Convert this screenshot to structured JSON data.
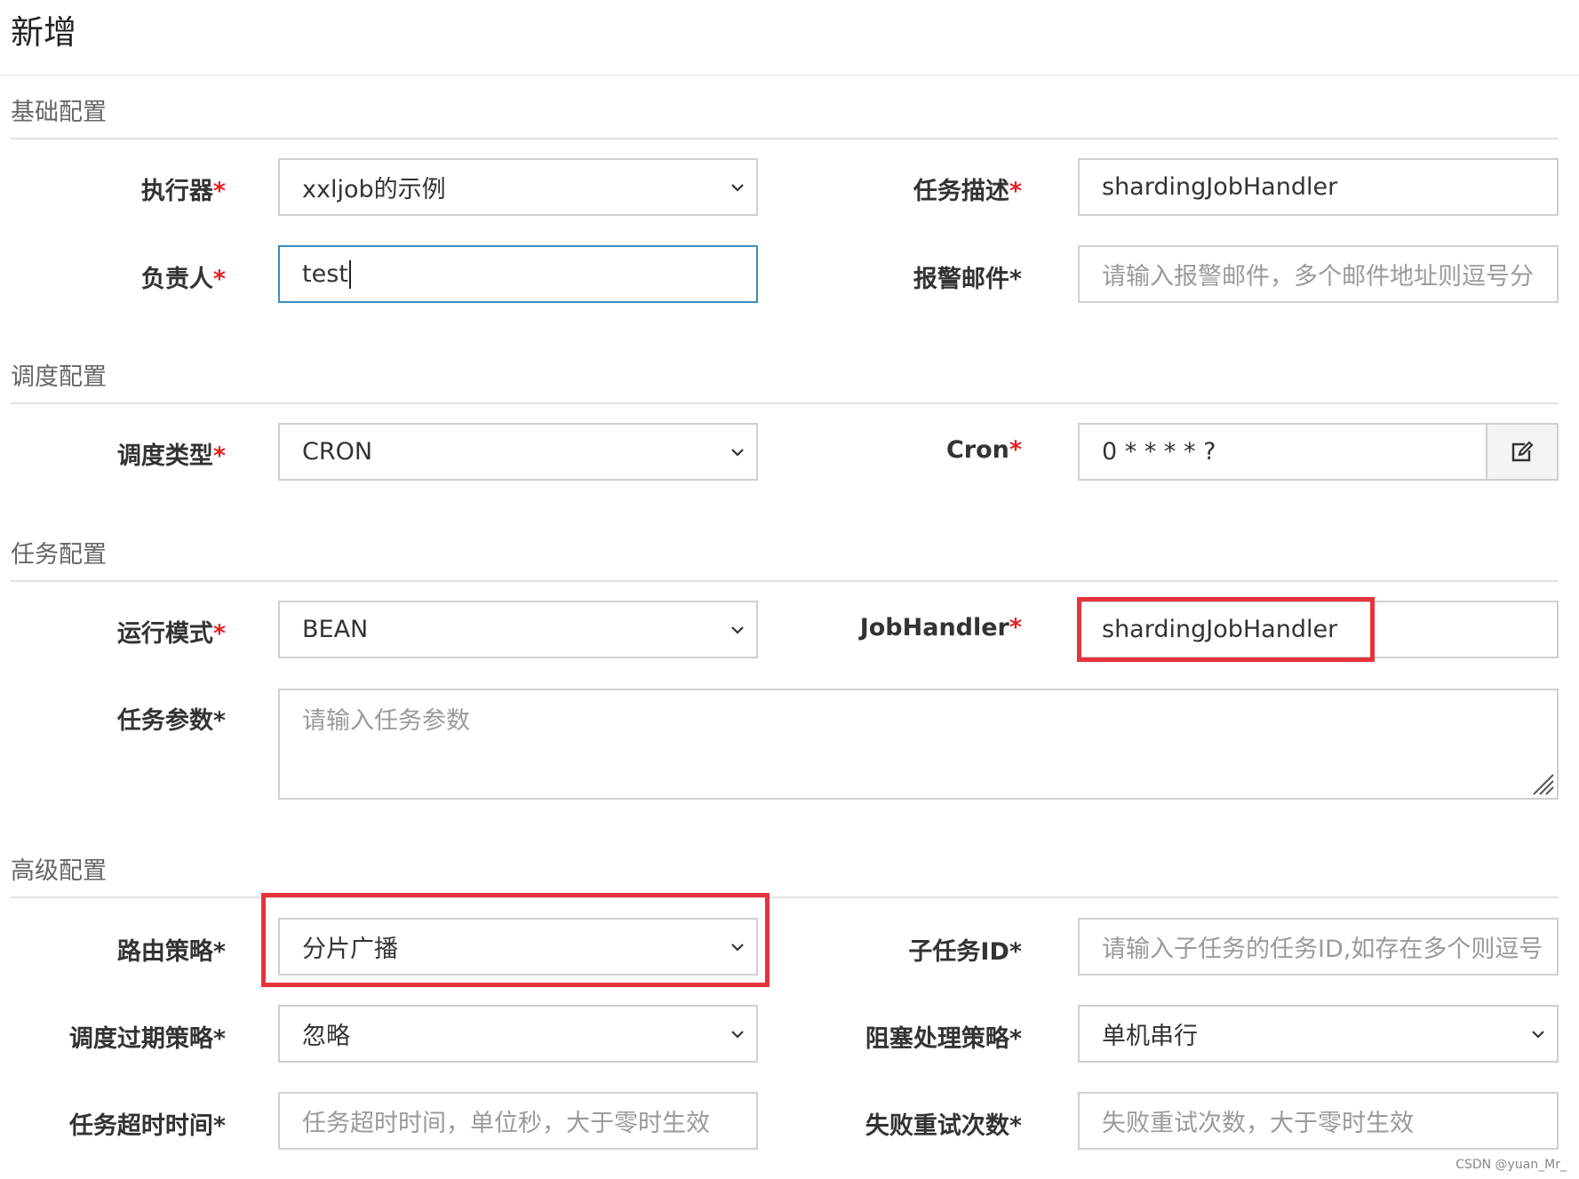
{
  "page": {
    "title": "新增",
    "watermark": "CSDN @yuan_Mr_"
  },
  "sections": {
    "basic": "基础配置",
    "schedule": "调度配置",
    "task": "任务配置",
    "advanced": "高级配置"
  },
  "required_marker": "*",
  "fields": {
    "executor": {
      "label": "执行器",
      "value": "xxljob的示例"
    },
    "job_desc": {
      "label": "任务描述",
      "value": "shardingJobHandler"
    },
    "author": {
      "label": "负责人",
      "value": "test"
    },
    "alarm_email": {
      "label": "报警邮件",
      "placeholder": "请输入报警邮件，多个邮件地址则逗号分"
    },
    "schedule_type": {
      "label": "调度类型",
      "value": "CRON"
    },
    "cron": {
      "label": "Cron",
      "value": "0 * * * * ?"
    },
    "glue_type": {
      "label": "运行模式",
      "value": "BEAN"
    },
    "job_handler": {
      "label": "JobHandler",
      "value": "shardingJobHandler"
    },
    "job_param": {
      "label": "任务参数",
      "placeholder": "请输入任务参数"
    },
    "route_strategy": {
      "label": "路由策略",
      "value": "分片广播"
    },
    "child_job_id": {
      "label": "子任务ID",
      "placeholder": "请输入子任务的任务ID,如存在多个则逗号"
    },
    "misfire_strategy": {
      "label": "调度过期策略",
      "value": "忽略"
    },
    "block_strategy": {
      "label": "阻塞处理策略",
      "value": "单机串行"
    },
    "timeout": {
      "label": "任务超时时间",
      "placeholder": "任务超时时间，单位秒，大于零时生效"
    },
    "fail_retry": {
      "label": "失败重试次数",
      "placeholder": "失败重试次数，大于零时生效"
    }
  },
  "icons": {
    "select": "chevron-down-icon",
    "cron_edit": "edit-icon",
    "resize": "resize-handle-icon"
  },
  "colors": {
    "required": "#e62020",
    "highlight": "#e8323a",
    "focus": "#3c8dbc"
  }
}
